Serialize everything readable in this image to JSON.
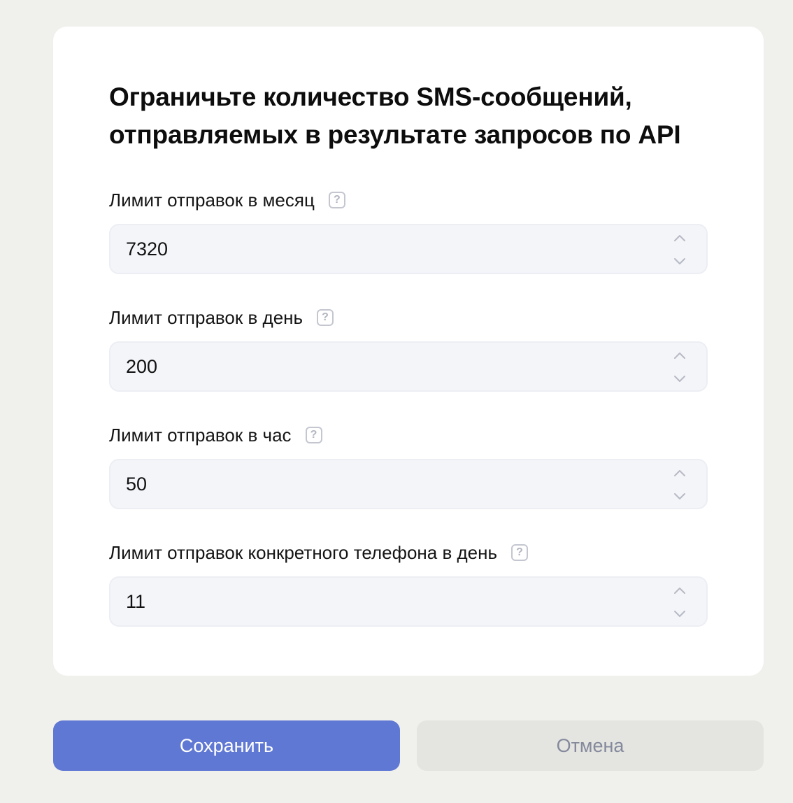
{
  "card": {
    "title_line1": "Ограничьте количество SMS-сообщений,",
    "title_line2": "отправляемых в результате запросов по API"
  },
  "fields": [
    {
      "label": "Лимит отправок в месяц",
      "value": "7320",
      "help_icon": "question-square-icon"
    },
    {
      "label": "Лимит отправок в день",
      "value": "200",
      "help_icon": "question-square-icon"
    },
    {
      "label": "Лимит отправок в час",
      "value": "50",
      "help_icon": "question-square-icon"
    },
    {
      "label": "Лимит отправок конкретного телефона в день",
      "value": "11",
      "help_icon": "question-square-icon"
    }
  ],
  "help_glyph": "?",
  "buttons": {
    "save_label": "Сохранить",
    "cancel_label": "Отмена"
  },
  "colors": {
    "page_background": "#f0f0ec",
    "card_background": "#ffffff",
    "input_background": "#f4f5f9",
    "primary": "#5f78d4",
    "secondary_button": "#e4e4e1",
    "secondary_text": "#848a9c",
    "icon_gray": "#c4c7d0"
  }
}
